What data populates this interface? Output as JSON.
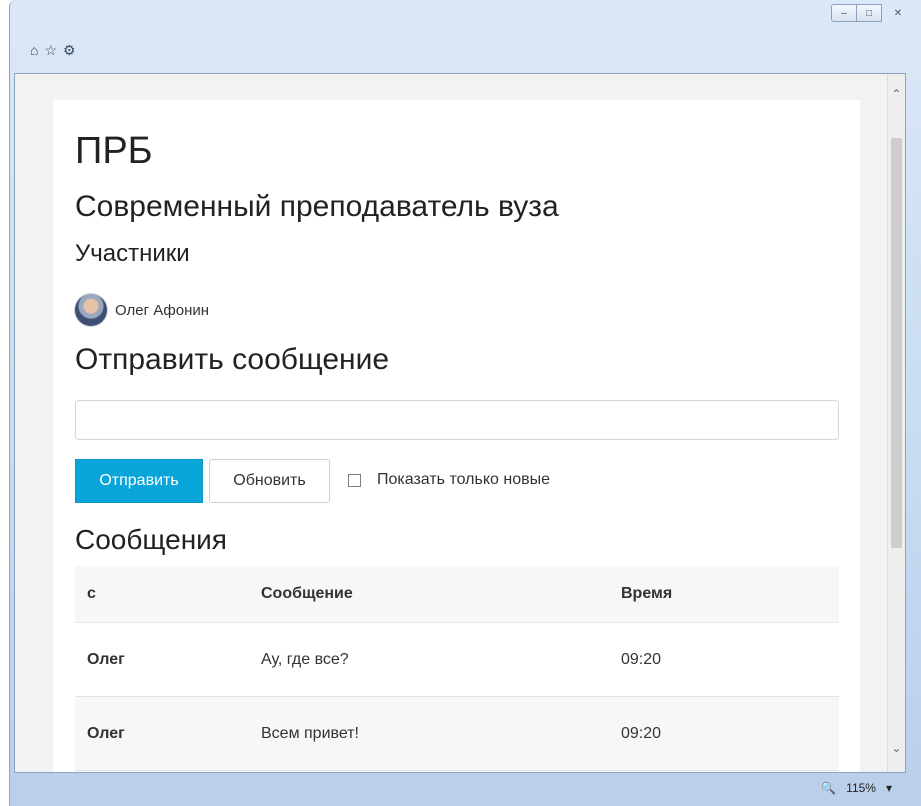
{
  "window": {
    "controls": {
      "minimize": "–",
      "maximize": "□",
      "close": "✕"
    },
    "toolbar_icons": [
      "home-icon",
      "star-icon",
      "gear-icon"
    ]
  },
  "page": {
    "title": "ПРБ",
    "subtitle": "Современный преподаватель вуза",
    "participants_heading": "Участники",
    "participant": {
      "name": "Олег Афонин",
      "avatar": "avatar-photo"
    },
    "send_heading": "Отправить сообщение",
    "message_input": {
      "value": "",
      "placeholder": ""
    },
    "send_button": "Отправить",
    "refresh_button": "Обновить",
    "only_new_checkbox": {
      "label": "Показать только новые",
      "checked": false
    },
    "messages_heading": "Сообщения",
    "table": {
      "headers": [
        "с",
        "Сообщение",
        "Время"
      ],
      "rows": [
        {
          "from": "Олег",
          "message": "Ау, где все?",
          "time": "09:20"
        },
        {
          "from": "Олег",
          "message": "Всем привет!",
          "time": "09:20"
        }
      ]
    }
  },
  "statusbar": {
    "zoom": "115%"
  },
  "colors": {
    "accent": "#0aa5d8",
    "table_header_bg": "#f7f7f7"
  }
}
